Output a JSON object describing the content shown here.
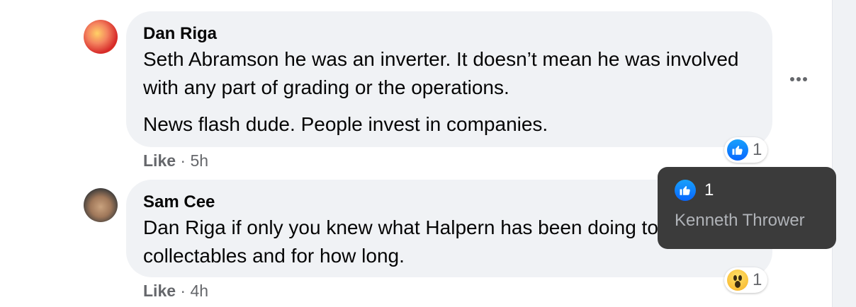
{
  "comments": [
    {
      "author": "Dan Riga",
      "lines": [
        "Seth Abramson he was an inverter. It doesn’t mean he was involved with any part of grading or the operations.",
        "News flash dude. People invest in companies."
      ],
      "action_like": "Like",
      "separator": " · ",
      "time": "5h",
      "reaction": {
        "icon": "like-icon",
        "count": "1"
      }
    },
    {
      "author": "Sam Cee",
      "lines": [
        "Dan Riga if only you knew what Halpern has been doing to collectables and for how long."
      ],
      "action_like": "Like",
      "separator": " · ",
      "time": "4h",
      "reaction": {
        "icon": "wow-icon",
        "count": "1"
      }
    }
  ],
  "tooltip": {
    "count": "1",
    "name": "Kenneth Thrower"
  },
  "colors": {
    "bubble": "#f0f2f5",
    "like_blue": "#0866ff",
    "meta_gray": "#65676b",
    "tooltip_bg": "#303030"
  }
}
